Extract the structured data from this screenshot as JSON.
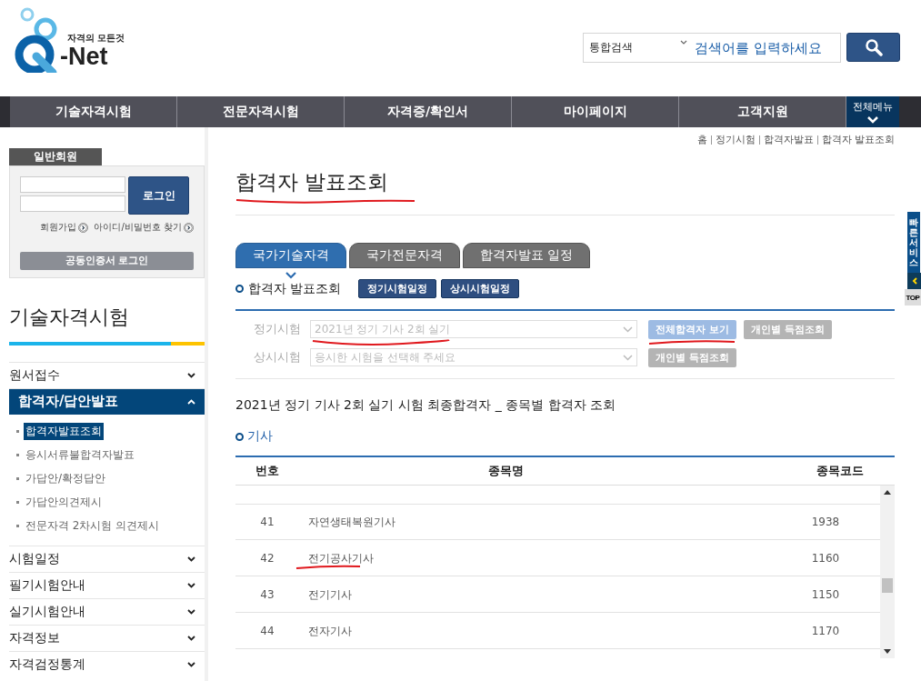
{
  "logo": {
    "tagline": "자격의 모든것",
    "name": "-Net"
  },
  "search": {
    "scope": "통합검색",
    "placeholder": "검색어를 입력하세요"
  },
  "nav": {
    "items": [
      {
        "label": "기술자격시험"
      },
      {
        "label": "전문자격시험"
      },
      {
        "label": "자격증/확인서"
      },
      {
        "label": "마이페이지"
      },
      {
        "label": "고객지원"
      }
    ],
    "all_menu": "전체메뉴"
  },
  "login": {
    "tab": "일반회원",
    "button": "로그인",
    "links": [
      "회원가입",
      "아이디/비밀번호 찾기"
    ],
    "cert_button": "공동인증서 로그인"
  },
  "sidebar": {
    "title": "기술자격시험",
    "items": [
      {
        "label": "원서접수",
        "expanded": false
      },
      {
        "label": "합격자/답안발표",
        "expanded": true,
        "children": [
          {
            "label": "합격자발표조회",
            "selected": true
          },
          {
            "label": "응시서류불합격자발표",
            "selected": false
          },
          {
            "label": "가답안/확정답안",
            "selected": false
          },
          {
            "label": "가답안의견제시",
            "selected": false
          },
          {
            "label": "전문자격 2차시험 의견제시",
            "selected": false
          }
        ]
      },
      {
        "label": "시험일정",
        "expanded": false
      },
      {
        "label": "필기시험안내",
        "expanded": false
      },
      {
        "label": "실기시험안내",
        "expanded": false
      },
      {
        "label": "자격정보",
        "expanded": false
      },
      {
        "label": "자격검정통계",
        "expanded": false
      }
    ]
  },
  "breadcrumb": [
    "홈",
    "정기시험",
    "합격자발표",
    "합격자 발표조회"
  ],
  "page_title": {
    "text": "합격자 발표조회",
    "underlined": true
  },
  "tabs": [
    {
      "label": "국가기술자격",
      "selected": true
    },
    {
      "label": "국가전문자격",
      "selected": false
    },
    {
      "label": "합격자발표 일정",
      "selected": false
    }
  ],
  "section": {
    "title": "합격자 발표조회",
    "buttons": [
      "정기시험일정",
      "상시시험일정"
    ]
  },
  "filters": [
    {
      "label": "정기시험",
      "value": "2021년 정기 기사 2회 실기",
      "underlined": true,
      "buttons": [
        {
          "label": "전체합격자 보기",
          "kind": "primary",
          "underlined": true
        },
        {
          "label": "개인별 득점조회",
          "kind": "plain",
          "underlined": false
        }
      ]
    },
    {
      "label": "상시시험",
      "placeholder": "응시한 시험을 선택해 주세요",
      "underlined": false,
      "buttons": [
        {
          "label": "개인별 득점조회",
          "kind": "plain",
          "underlined": false
        }
      ]
    }
  ],
  "result_title": "2021년 정기 기사 2회 실기 시험 최종합격자 _ 종목별 합격자 조회",
  "group_title": "기사",
  "table": {
    "columns": [
      "번호",
      "종목명",
      "종목코드"
    ],
    "rows": [
      {
        "no": "41",
        "name": "자연생태복원기사",
        "code": "1938",
        "underlined": false
      },
      {
        "no": "42",
        "name": "전기공사기사",
        "code": "1160",
        "underlined": true
      },
      {
        "no": "43",
        "name": "전기기사",
        "code": "1150",
        "underlined": false
      },
      {
        "no": "44",
        "name": "전자기사",
        "code": "1170",
        "underlined": false
      }
    ]
  },
  "quick_service": {
    "label": "빠른서비스",
    "top": "TOP"
  }
}
